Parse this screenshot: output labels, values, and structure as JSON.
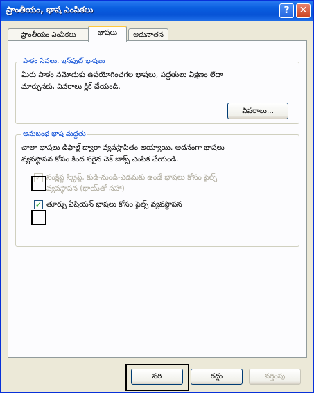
{
  "window": {
    "title": "ప్రాంతీయం, భాష ఎంపికలు",
    "help_label": "?",
    "close_label": "✕"
  },
  "tabs": [
    {
      "label": "ప్రాంతీయం ఎంపికలు",
      "active": false
    },
    {
      "label": "భాషలు",
      "active": true
    },
    {
      "label": "అధునాతన",
      "active": false
    }
  ],
  "text_services": {
    "legend": "పాఠం సేవలు, ఇన్‌పుట్ భాషలు",
    "description_line1": "మీరు పాఠం నమోదుకు ఉపయోగించగల భాషలు, పద్ధతులు వీక్షణం లేదా",
    "description_line2": "మార్పునకు, వివరాలు క్లిక్ చేయండి.",
    "details_button": "వివరాలు..."
  },
  "supplemental": {
    "legend": "అనుబంధ భాష మద్దతు",
    "description_line1": "చాలా భాషలు డిఫాల్ట్ ద్వారా వ్యవస్థాపితం అయ్యాయి. అదనంగా భాషలు",
    "description_line2": "వ్యవస్థాపన కోసం కింద సరైన చెక్ బాక్స్ ఎంపిక చేయండి.",
    "checkbox1": {
      "line1": "సంక్లిష్ట స్క్రిప్ట్, కుడి-నుండి-ఎడమకు ఉండే భాషలు కోసం ఫైల్స్",
      "line2": "వ్యవస్థాపన (థాయ్‌తో సహా)",
      "checked": true,
      "enabled": false
    },
    "checkbox2": {
      "label": "తూర్పు ఏషియన్ భాషలు కోసం ఫైల్స్ వ్యవస్థాపన",
      "checked": true,
      "enabled": true
    }
  },
  "footer": {
    "ok_label": "సరి",
    "cancel_label": "రద్దు",
    "apply_label": "వర్తింపు"
  },
  "colors": {
    "title_bar": "#0a5fe0",
    "group_legend": "#0046d5",
    "dialog_face": "#ece9d8",
    "active_tab_accent": "#ffc83c",
    "checkmark": "#21a121"
  }
}
